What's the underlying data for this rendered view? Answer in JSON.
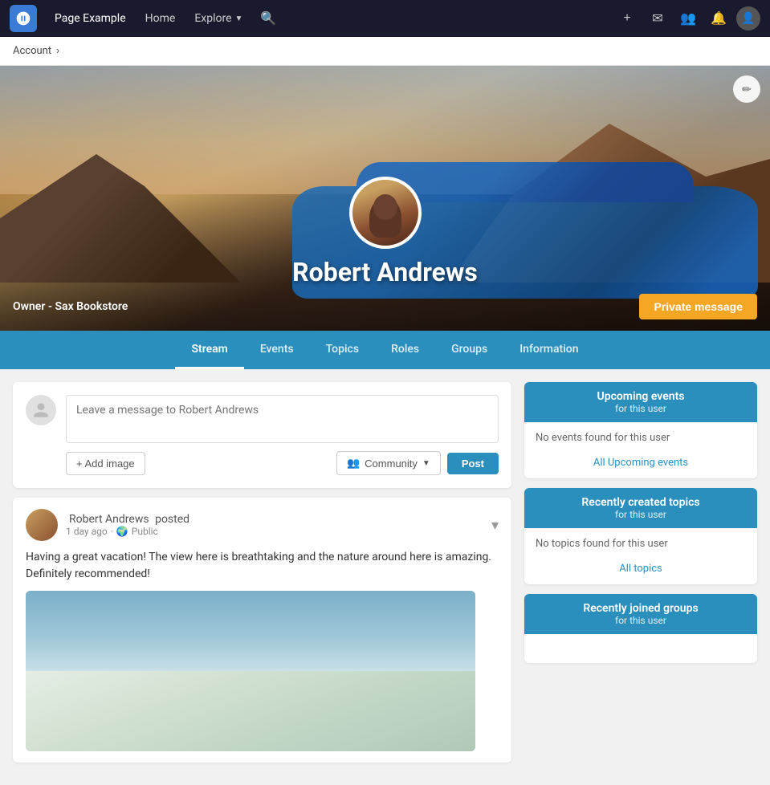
{
  "app": {
    "logo_label": "BuddyPress",
    "nav": {
      "page_example": "Page Example",
      "home": "Home",
      "explore": "Explore",
      "explore_has_dropdown": true
    },
    "topnav_right": {
      "create_icon": "+",
      "mail_icon": "✉",
      "members_icon": "👥",
      "notifications_icon": "🔔",
      "avatar_icon": "👤"
    }
  },
  "breadcrumb": {
    "account_label": "Account",
    "separator": "›"
  },
  "hero": {
    "edit_icon": "✏",
    "user_name": "Robert Andrews",
    "role_label": "Owner",
    "org_label": "Sax Bookstore",
    "role_separator": "-",
    "private_message_btn": "Private message"
  },
  "profile_tabs": [
    {
      "id": "stream",
      "label": "Stream",
      "active": true
    },
    {
      "id": "events",
      "label": "Events",
      "active": false
    },
    {
      "id": "topics",
      "label": "Topics",
      "active": false
    },
    {
      "id": "roles",
      "label": "Roles",
      "active": false
    },
    {
      "id": "groups",
      "label": "Groups",
      "active": false
    },
    {
      "id": "information",
      "label": "Information",
      "active": false
    }
  ],
  "stream": {
    "post_box": {
      "placeholder": "Leave a message to Robert Andrews",
      "add_image_label": "+ Add image",
      "community_label": "Community",
      "post_label": "Post"
    },
    "posts": [
      {
        "id": 1,
        "user_name": "Robert Andrews",
        "action": "posted",
        "time_ago": "1 day ago",
        "visibility": "Public",
        "visibility_icon": "🌍",
        "text": "Having a great vacation! The view here is breathtaking and the nature around here is amazing. Definitely recommended!",
        "has_image": true
      }
    ]
  },
  "sidebar": {
    "upcoming_events": {
      "title": "Upcoming events",
      "subtitle": "for this user",
      "empty_text": "No events found for this user",
      "all_link": "All Upcoming events"
    },
    "recently_created_topics": {
      "title": "Recently created topics",
      "subtitle": "for this user",
      "empty_text": "No topics found for this user",
      "all_link": "All topics"
    },
    "recently_joined_groups": {
      "title": "Recently joined groups",
      "subtitle": "for this user"
    }
  }
}
